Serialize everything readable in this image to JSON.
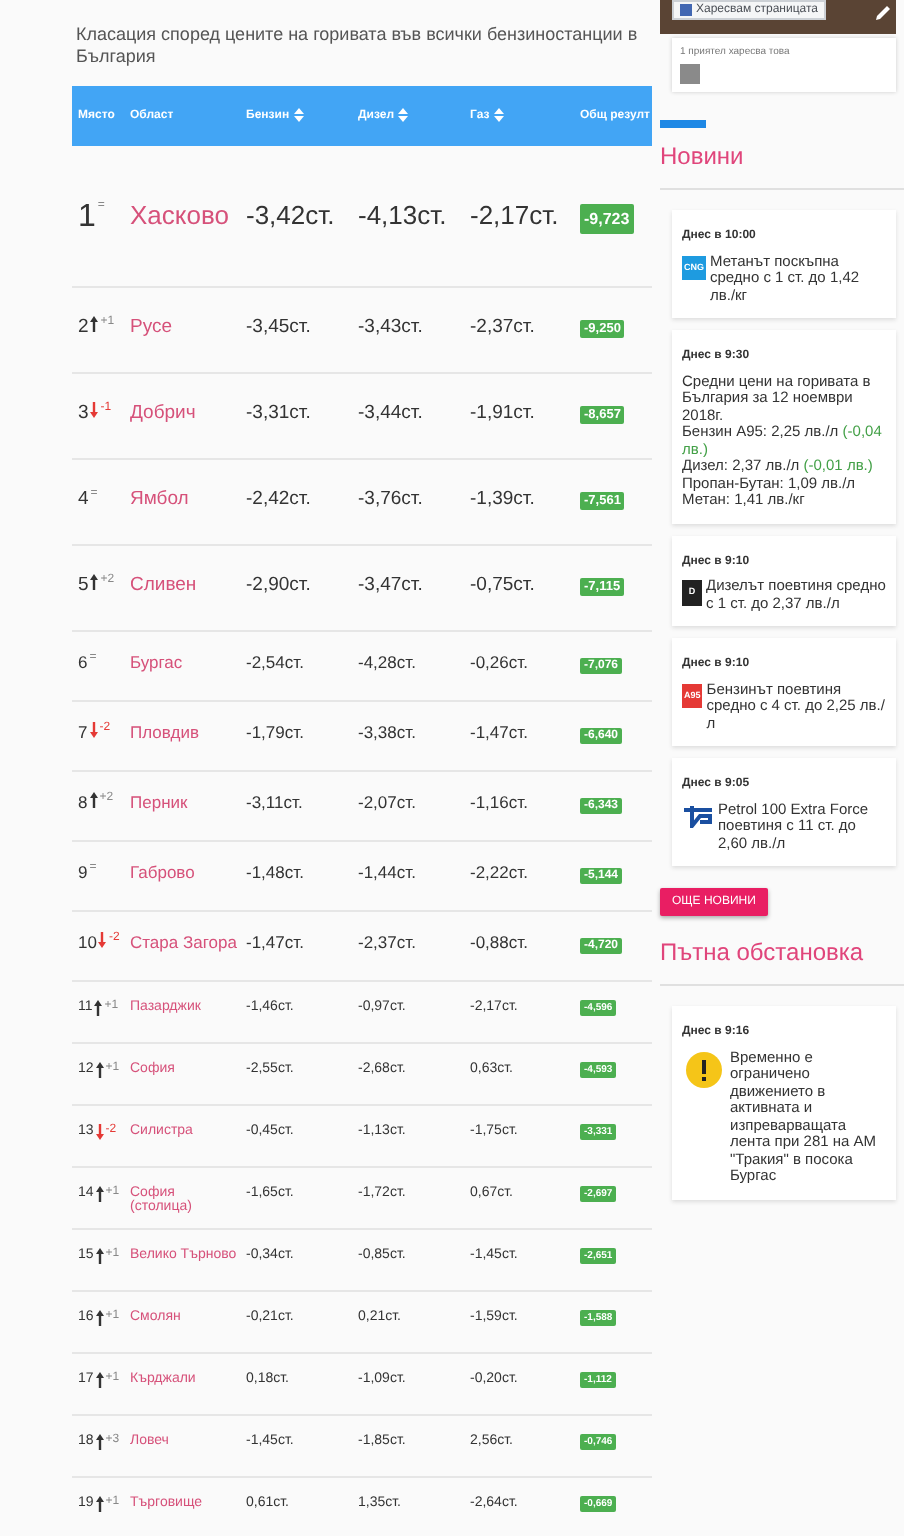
{
  "title": "Класация според цените на горивата във всички бензиностанции в България",
  "table": {
    "columns": [
      {
        "label": "Място",
        "sortable": false
      },
      {
        "label": "Област",
        "sortable": false
      },
      {
        "label": "Бензин",
        "sortable": true
      },
      {
        "label": "Дизел",
        "sortable": true
      },
      {
        "label": "Газ",
        "sortable": true
      },
      {
        "label": "Общ резулт",
        "sortable": false
      }
    ],
    "rows": [
      {
        "rank": "1",
        "kind": "same",
        "change": "=",
        "region": "Хасково",
        "petrol": "-3,42ст.",
        "diesel": "-4,13ст.",
        "gas": "-2,17ст.",
        "total": "-9,723"
      },
      {
        "rank": "2",
        "kind": "up",
        "change": "+1",
        "region": "Русе",
        "petrol": "-3,45ст.",
        "diesel": "-3,43ст.",
        "gas": "-2,37ст.",
        "total": "-9,250"
      },
      {
        "rank": "3",
        "kind": "down",
        "change": "-1",
        "region": "Добрич",
        "petrol": "-3,31ст.",
        "diesel": "-3,44ст.",
        "gas": "-1,91ст.",
        "total": "-8,657"
      },
      {
        "rank": "4",
        "kind": "same",
        "change": "=",
        "region": "Ямбол",
        "petrol": "-2,42ст.",
        "diesel": "-3,76ст.",
        "gas": "-1,39ст.",
        "total": "-7,561"
      },
      {
        "rank": "5",
        "kind": "up",
        "change": "+2",
        "region": "Сливен",
        "petrol": "-2,90ст.",
        "diesel": "-3,47ст.",
        "gas": "-0,75ст.",
        "total": "-7,115"
      },
      {
        "rank": "6",
        "kind": "same",
        "change": "=",
        "region": "Бургас",
        "petrol": "-2,54ст.",
        "diesel": "-4,28ст.",
        "gas": "-0,26ст.",
        "total": "-7,076"
      },
      {
        "rank": "7",
        "kind": "down",
        "change": "-2",
        "region": "Пловдив",
        "petrol": "-1,79ст.",
        "diesel": "-3,38ст.",
        "gas": "-1,47ст.",
        "total": "-6,640"
      },
      {
        "rank": "8",
        "kind": "up",
        "change": "+2",
        "region": "Перник",
        "petrol": "-3,11ст.",
        "diesel": "-2,07ст.",
        "gas": "-1,16ст.",
        "total": "-6,343"
      },
      {
        "rank": "9",
        "kind": "same",
        "change": "=",
        "region": "Габрово",
        "petrol": "-1,48ст.",
        "diesel": "-1,44ст.",
        "gas": "-2,22ст.",
        "total": "-5,144"
      },
      {
        "rank": "10",
        "kind": "down",
        "change": "-2",
        "region": "Стара Загора",
        "petrol": "-1,47ст.",
        "diesel": "-2,37ст.",
        "gas": "-0,88ст.",
        "total": "-4,720"
      },
      {
        "rank": "11",
        "kind": "up",
        "change": "+1",
        "region": "Пазарджик",
        "petrol": "-1,46ст.",
        "diesel": "-0,97ст.",
        "gas": "-2,17ст.",
        "total": "-4,596"
      },
      {
        "rank": "12",
        "kind": "up",
        "change": "+1",
        "region": "София",
        "petrol": "-2,55ст.",
        "diesel": "-2,68ст.",
        "gas": "0,63ст.",
        "total": "-4,593"
      },
      {
        "rank": "13",
        "kind": "down",
        "change": "-2",
        "region": "Силистра",
        "petrol": "-0,45ст.",
        "diesel": "-1,13ст.",
        "gas": "-1,75ст.",
        "total": "-3,331"
      },
      {
        "rank": "14",
        "kind": "up",
        "change": "+1",
        "region": "София (столица)",
        "petrol": "-1,65ст.",
        "diesel": "-1,72ст.",
        "gas": "0,67ст.",
        "total": "-2,697"
      },
      {
        "rank": "15",
        "kind": "up",
        "change": "+1",
        "region": "Велико Търново",
        "petrol": "-0,34ст.",
        "diesel": "-0,85ст.",
        "gas": "-1,45ст.",
        "total": "-2,651"
      },
      {
        "rank": "16",
        "kind": "up",
        "change": "+1",
        "region": "Смолян",
        "petrol": "-0,21ст.",
        "diesel": "0,21ст.",
        "gas": "-1,59ст.",
        "total": "-1,588"
      },
      {
        "rank": "17",
        "kind": "up",
        "change": "+1",
        "region": "Кърджали",
        "petrol": "0,18ст.",
        "diesel": "-1,09ст.",
        "gas": "-0,20ст.",
        "total": "-1,112"
      },
      {
        "rank": "18",
        "kind": "up",
        "change": "+3",
        "region": "Ловеч",
        "petrol": "-1,45ст.",
        "diesel": "-1,85ст.",
        "gas": "2,56ст.",
        "total": "-0,746"
      },
      {
        "rank": "19",
        "kind": "up",
        "change": "+1",
        "region": "Търговище",
        "petrol": "0,61ст.",
        "diesel": "1,35ст.",
        "gas": "-2,64ст.",
        "total": "-0,669"
      }
    ]
  },
  "facebook": {
    "like_button": "Харесвам страницата",
    "friends": "1 приятел харесва това"
  },
  "news": {
    "heading": "Новини",
    "items": [
      {
        "time": "Днес в 10:00",
        "icon": {
          "kind": "label",
          "text": "CNG",
          "color": "#1e9be0"
        },
        "lines": [
          [
            {
              "text": "Метанът поскъпна средно с 1 ст. до 1,42 лв./кг",
              "kind": "plain"
            }
          ]
        ]
      },
      {
        "time": "Днес в 9:30",
        "icon": {
          "kind": "none"
        },
        "lines": [
          [
            {
              "text": "Средни цени на горивата в България за 12 ноември 2018г.",
              "kind": "plain"
            }
          ],
          [
            {
              "text": "Бензин А95: 2,25 лв./л ",
              "kind": "plain"
            },
            {
              "text": "(-0,04 лв.)",
              "kind": "change"
            }
          ],
          [
            {
              "text": "Дизел: 2,37 лв./л ",
              "kind": "plain"
            },
            {
              "text": "(-0,01 лв.)",
              "kind": "change"
            }
          ],
          [
            {
              "text": "Пропан-Бутан: 1,09 лв./л",
              "kind": "plain"
            }
          ],
          [
            {
              "text": "Метан: 1,41 лв./кг",
              "kind": "plain"
            }
          ]
        ]
      },
      {
        "time": "Днес в 9:10",
        "icon": {
          "kind": "label",
          "text": "D",
          "color": "#222222"
        },
        "lines": [
          [
            {
              "text": "Дизелът поевтиня средно с 1 ст. до 2,37 лв./л",
              "kind": "plain"
            }
          ]
        ]
      },
      {
        "time": "Днес в 9:10",
        "icon": {
          "kind": "label",
          "text": "A95",
          "color": "#e53935"
        },
        "lines": [
          [
            {
              "text": "Бензинът поевтиня средно с 4 ст. до 2,25 лв./л",
              "kind": "plain"
            }
          ]
        ]
      },
      {
        "time": "Днес в 9:05",
        "icon": {
          "kind": "logo"
        },
        "lines": [
          [
            {
              "text": "Petrol 100 Extra Force поевтиня с 11 ст. до 2,60 лв./л",
              "kind": "plain"
            }
          ]
        ]
      }
    ],
    "more_button": "ОЩЕ НОВИНИ"
  },
  "traffic": {
    "heading": "Пътна обстановка",
    "items": [
      {
        "time": "Днес в 9:16",
        "icon": {
          "kind": "warning"
        },
        "lines": [
          [
            {
              "text": "Временно е ограничено движението в активната и изпреварващата лента при 281 на АМ \"Тракия\" в посока Бургас",
              "kind": "plain"
            }
          ]
        ]
      }
    ]
  }
}
